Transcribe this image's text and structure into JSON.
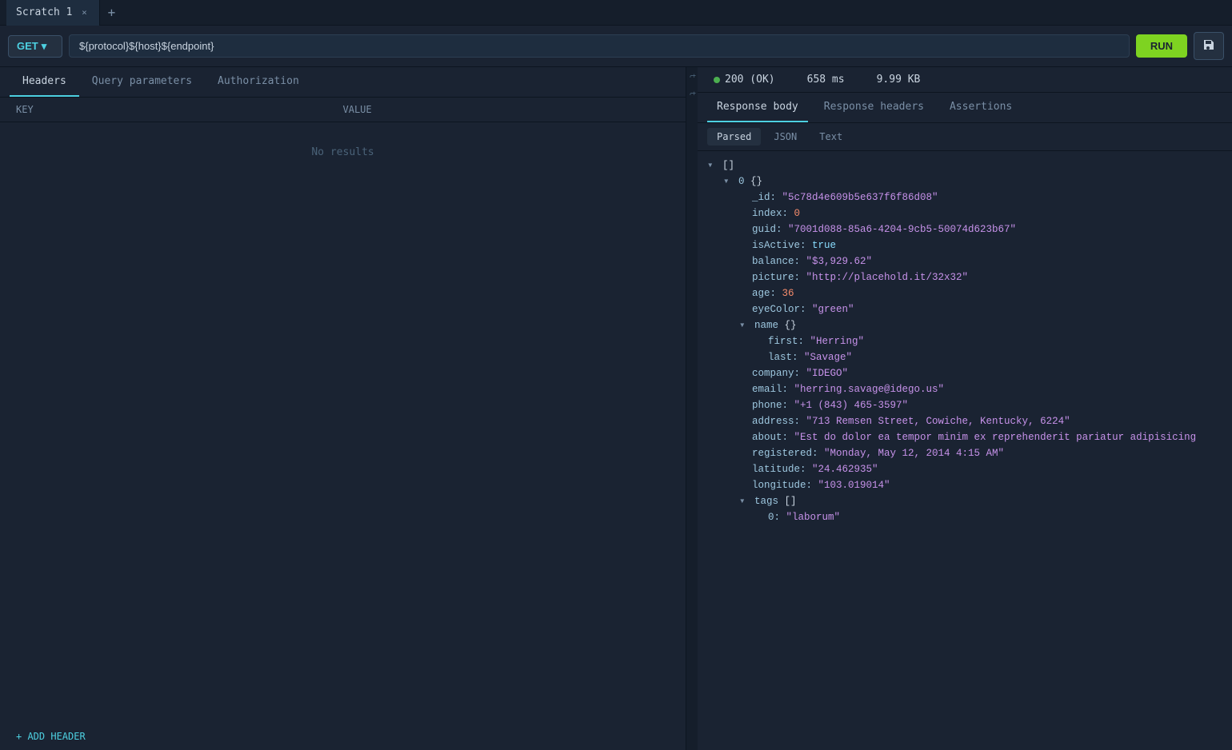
{
  "tabs": {
    "items": [
      {
        "label": "Scratch 1",
        "active": true
      }
    ],
    "add_label": "+"
  },
  "url_bar": {
    "method": "GET",
    "method_dropdown_icon": "▾",
    "url_value": "${protocol}${host}${endpoint}",
    "url_parts": {
      "protocol": "${protocol}",
      "host": "${host}",
      "endpoint": "${endpoint}"
    },
    "run_label": "RUN",
    "save_icon": "💾"
  },
  "left_panel": {
    "sub_tabs": [
      {
        "label": "Headers",
        "active": true
      },
      {
        "label": "Query parameters",
        "active": false
      },
      {
        "label": "Authorization",
        "active": false
      }
    ],
    "table": {
      "key_header": "Key",
      "value_header": "Value",
      "no_results": "No results"
    },
    "add_header_label": "+ ADD HEADER"
  },
  "right_panel": {
    "status": {
      "code": "200 (OK)",
      "time": "658 ms",
      "size": "9.99 KB"
    },
    "response_tabs": [
      {
        "label": "Response body",
        "active": true
      },
      {
        "label": "Response headers",
        "active": false
      },
      {
        "label": "Assertions",
        "active": false
      }
    ],
    "view_tabs": [
      {
        "label": "Parsed",
        "active": true
      },
      {
        "label": "JSON",
        "active": false
      },
      {
        "label": "Text",
        "active": false
      }
    ],
    "json_data": {
      "lines": [
        {
          "indent": 0,
          "toggle": "▾",
          "content": "[]",
          "type": "bracket"
        },
        {
          "indent": 1,
          "toggle": "▾",
          "key": "0",
          "content": "{}",
          "type": "object-key"
        },
        {
          "indent": 2,
          "key": "_id",
          "value": "\"5c78d4e609b5e637f6f86d08\"",
          "type": "string"
        },
        {
          "indent": 2,
          "key": "index",
          "value": "0",
          "type": "number"
        },
        {
          "indent": 2,
          "key": "guid",
          "value": "\"7001d088-85a6-4204-9cb5-50074d623b67\"",
          "type": "string"
        },
        {
          "indent": 2,
          "key": "isActive",
          "value": "true",
          "type": "bool"
        },
        {
          "indent": 2,
          "key": "balance",
          "value": "\"$3,929.62\"",
          "type": "string"
        },
        {
          "indent": 2,
          "key": "picture",
          "value": "\"http://placehold.it/32x32\"",
          "type": "string"
        },
        {
          "indent": 2,
          "key": "age",
          "value": "36",
          "type": "number"
        },
        {
          "indent": 2,
          "key": "eyeColor",
          "value": "\"green\"",
          "type": "string"
        },
        {
          "indent": 2,
          "toggle": "▾",
          "key": "name",
          "content": "{}",
          "type": "object-key"
        },
        {
          "indent": 3,
          "key": "first",
          "value": "\"Herring\"",
          "type": "string"
        },
        {
          "indent": 3,
          "key": "last",
          "value": "\"Savage\"",
          "type": "string"
        },
        {
          "indent": 2,
          "key": "company",
          "value": "\"IDEGO\"",
          "type": "string"
        },
        {
          "indent": 2,
          "key": "email",
          "value": "\"herring.savage@idego.us\"",
          "type": "string"
        },
        {
          "indent": 2,
          "key": "phone",
          "value": "\"+1 (843) 465-3597\"",
          "type": "string"
        },
        {
          "indent": 2,
          "key": "address",
          "value": "\"713 Remsen Street, Cowiche, Kentucky, 6224\"",
          "type": "string"
        },
        {
          "indent": 2,
          "key": "about",
          "value": "\"Est do dolor ea tempor minim ex reprehenderit pariatur adipisicing",
          "type": "string"
        },
        {
          "indent": 2,
          "key": "registered",
          "value": "\"Monday, May 12, 2014 4:15 AM\"",
          "type": "string"
        },
        {
          "indent": 2,
          "key": "latitude",
          "value": "\"24.462935\"",
          "type": "string"
        },
        {
          "indent": 2,
          "key": "longitude",
          "value": "\"103.019014\"",
          "type": "string"
        },
        {
          "indent": 2,
          "toggle": "▾",
          "key": "tags",
          "content": "[]",
          "type": "array-key"
        },
        {
          "indent": 3,
          "key": "0",
          "value": "\"laborum\"",
          "type": "string"
        }
      ]
    }
  }
}
